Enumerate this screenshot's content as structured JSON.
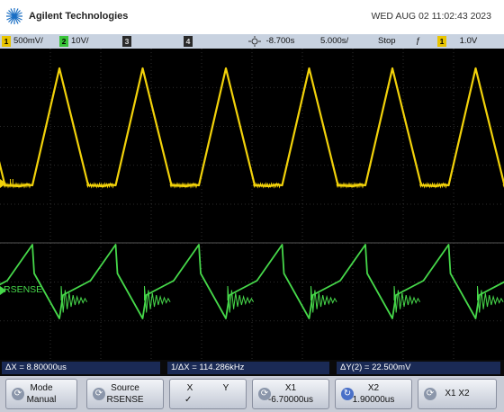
{
  "header": {
    "brand": "Agilent Technologies",
    "datetime": "WED AUG 02 11:02:43 2023"
  },
  "statusbar": {
    "ch1": {
      "number": "1",
      "scale": "500mV/",
      "color": "#e8c400"
    },
    "ch2": {
      "number": "2",
      "scale": "10V/",
      "color": "#3ac43a"
    },
    "ch3": {
      "number": "3"
    },
    "ch4": {
      "number": "4"
    },
    "trigger_icon": "trigger-icon",
    "delay": "-8.700s",
    "timebase": "5.000s/",
    "run_state": "Stop",
    "trigger_slope": "ƒ",
    "trigger_channel": "1",
    "trigger_level": "1.0V"
  },
  "traces": {
    "ch1_label": "IL",
    "ch2_label": "RSENSE",
    "ch1_color": "#f2d20a",
    "ch2_color": "#46d84a"
  },
  "measurements": {
    "dx": "ΔX = 8.80000us",
    "inv_dx": "1/ΔX = 114.286kHz",
    "dy": "ΔY(2) = 22.500mV"
  },
  "softkeys": [
    {
      "line1": "Mode",
      "line2": "Manual",
      "icon": "knob-icon"
    },
    {
      "line1": "Source",
      "line2": "RSENSE",
      "icon": "knob-icon"
    },
    {
      "line1": "X",
      "line2": "✓",
      "line1b": "Y",
      "icon": ""
    },
    {
      "line1": "X1",
      "line2": "-6.70000us",
      "icon": "knob-icon"
    },
    {
      "line1": "X2",
      "line2": "1.90000us",
      "icon": "rotate-knob-icon"
    },
    {
      "line1": "X1 X2",
      "line2": "",
      "icon": "knob-icon"
    }
  ]
}
